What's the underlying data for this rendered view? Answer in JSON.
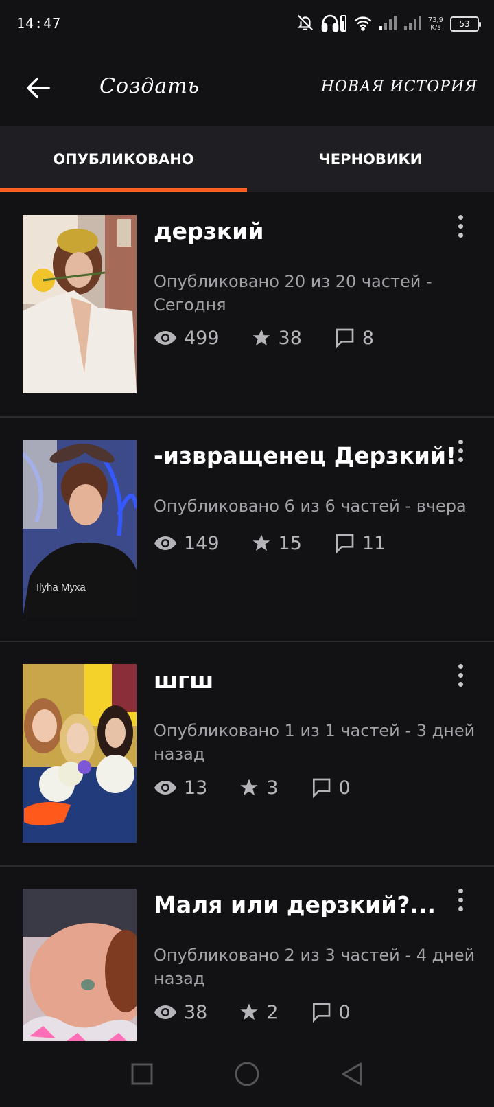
{
  "status_bar": {
    "time": "14:47",
    "net_speed_value": "73,9",
    "net_speed_unit": "K/s",
    "battery": "53",
    "icons": [
      "notifications-off-icon",
      "headphones-icon",
      "wifi-icon",
      "signal-icon",
      "signal-icon",
      "battery-icon"
    ]
  },
  "app_bar": {
    "title": "Создать",
    "new_story_label": "НОВАЯ ИСТОРИЯ",
    "back_icon": "arrow-left-icon"
  },
  "tabs": [
    {
      "label": "ОПУБЛИКОВАНО",
      "active": true
    },
    {
      "label": "ЧЕРНОВИКИ",
      "active": false
    }
  ],
  "colors": {
    "accent": "#ff6122",
    "background": "#121114",
    "tab_bar": "#1f1e22",
    "meta_text": "#a3a2a7"
  },
  "stories": [
    {
      "title": "дерзкий",
      "meta": "Опубликовано 20 из 20 частей - Сегодня",
      "views": "499",
      "votes": "38",
      "comments": "8"
    },
    {
      "title": "-извращенец Дерзкий!",
      "meta": "Опубликовано 6 из 6 частей - вчера",
      "views": "149",
      "votes": "15",
      "comments": "11"
    },
    {
      "title": "шгш",
      "meta": "Опубликовано 1 из 1 частей - 3 дней назад",
      "views": "13",
      "votes": "3",
      "comments": "0"
    },
    {
      "title": "Маля или дерзкий?...",
      "meta": "Опубликовано 2 из 3 частей - 4 дней назад",
      "views": "38",
      "votes": "2",
      "comments": "0"
    }
  ],
  "nav_bar": {
    "icons": [
      "recents-square-icon",
      "home-circle-icon",
      "back-triangle-icon"
    ]
  }
}
